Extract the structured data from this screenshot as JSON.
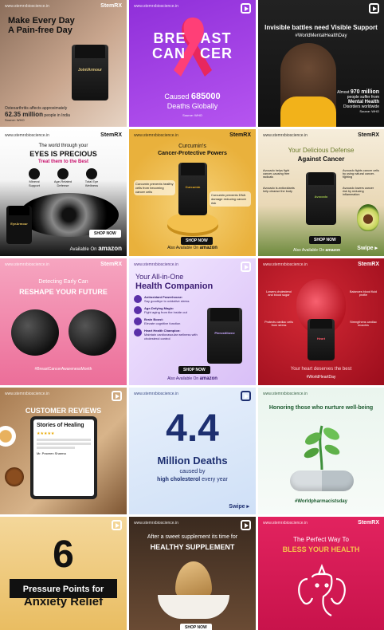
{
  "site": "www.stemrxbioscience.in",
  "brand": "StemRX",
  "tiles": [
    {
      "title_line1": "Make Every Day",
      "title_line2": "A Pain-free Day",
      "product": "JointArmour",
      "stat_prefix": "Osteoarthritis affects approximately",
      "stat": "62.35 million",
      "stat_suffix": "people in India",
      "source": "Source: WHO"
    },
    {
      "word_left": "BRE",
      "word_right": "AST",
      "word2_left": "CAN",
      "word2_right": "CER",
      "caused": "Caused",
      "number": "685000",
      "deaths": "Deaths Globally",
      "source": "Source: WHO"
    },
    {
      "heading": "Invisible battles need Visible Support",
      "hashtag": "#WorldMentalHealthDay",
      "almost": "Almost",
      "number": "970 million",
      "rest": "people suffer from",
      "bold": "Mental Health",
      "disorders": "Disorders worldwide",
      "source": "Source: WHO"
    },
    {
      "line1": "The world through your",
      "line2": "EYES IS PRECIOUS",
      "line3": "Treat them to the Best",
      "icons": [
        "Mineral Support",
        "Age-Related Defense",
        "Total Eye Wellness"
      ],
      "product": "EyeArmour",
      "shop": "SHOP NOW",
      "available": "Available On",
      "amazon": "amazon"
    },
    {
      "line1": "Curcumin's",
      "line2": "Cancer-Protective Powers",
      "note_left": "Curcumin prevents healthy cells from becoming cancer cells",
      "note_right": "Curcumin prevents DNA damage reducing cancer risk",
      "product": "Curcumin",
      "shop": "SHOP NOW",
      "available": "Also Available On",
      "amazon": "amazon"
    },
    {
      "line1": "Your Delicious Defense",
      "line2": "Against Cancer",
      "product": "Avocado",
      "points": [
        "Avocado helps fight cancer-causing free radicals",
        "Avocado fights cancer cells by using natural cancer-fighting",
        "Avocado is antioxidants help cleanse the body",
        "Avocado lowers cancer risk by reducing inflammation"
      ],
      "shop": "SHOP NOW",
      "available": "Also Available On",
      "amazon": "amazon",
      "swipe": "Swipe"
    },
    {
      "line1": "Detecting Early Can",
      "line2": "RESHAPE YOUR FUTURE",
      "hashtag": "#BreastCancerAwarenessMonth"
    },
    {
      "line1": "Your All-in-One",
      "line2": "Health Companion",
      "points": [
        {
          "title": "Antioxidant Powerhouse:",
          "text": "Say goodbye to oxidative stress"
        },
        {
          "title": "Age-Defying Magic:",
          "text": "Fight aging from the inside out"
        },
        {
          "title": "Brain Boost:",
          "text": "Elevate cognitive function"
        },
        {
          "title": "Heart Health Champion:",
          "text": "Maintain cardiovascular wellness with cholesterol control"
        }
      ],
      "product": "Pterostilbene",
      "shop": "SHOP NOW",
      "available": "Also Available On",
      "amazon": "amazon"
    },
    {
      "points": [
        "Lowers cholesterol and blood sugar",
        "Balances blood fluid profile",
        "Protects cardiac cells from stress",
        "Strengthens cardiac muscles"
      ],
      "product": "Heart",
      "tagline": "Your heart deserves the best",
      "hashtag": "#WorldHeartDay"
    },
    {
      "heading": "CUSTOMER REVIEWS",
      "card_title": "Stories of Healing",
      "stars": "★★★★★",
      "reviewer": "Mr. Praveen Sharma"
    },
    {
      "big": "4.4",
      "line1": "Million Deaths",
      "line2": "caused by",
      "line3": "high cholesterol",
      "line4": "every year",
      "swipe": "Swipe"
    },
    {
      "heading": "Honoring those who nurture well-being",
      "hashtag": "#Worldpharmacistsday"
    },
    {
      "big": "6",
      "line1": "Pressure Points for",
      "line2": "Anxiety Relief"
    },
    {
      "line1": "After a sweet supplement its time for",
      "line2": "HEALTHY SUPPLEMENT",
      "shop": "SHOP NOW"
    },
    {
      "line1": "The Perfect Way To",
      "line2": "BLESS YOUR HEALTH"
    }
  ]
}
